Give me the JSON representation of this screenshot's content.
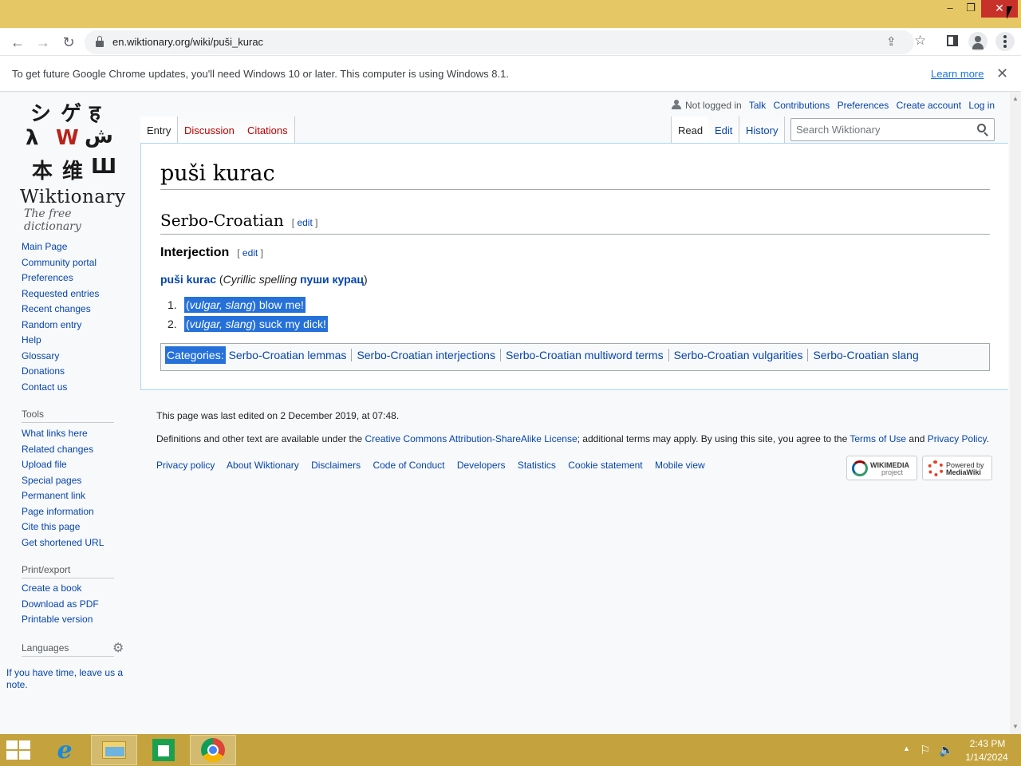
{
  "window": {
    "minimize_label": "‒",
    "restore_label": "❐",
    "close_label": "✕"
  },
  "toolbar": {
    "url": "en.wiktionary.org/wiki/puši_kurac",
    "back_icon": "arrow-left",
    "forward_icon": "arrow-right",
    "reload_icon": "reload"
  },
  "infobar": {
    "message": "To get future Google Chrome updates, you'll need Windows 10 or later. This computer is using Windows 8.1.",
    "learn_more": "Learn more",
    "close_label": "✕"
  },
  "logo": {
    "glyphs": [
      "シ",
      "ゲ",
      "ह",
      "λ",
      "W",
      "ش",
      "本",
      "维",
      "Ш"
    ],
    "wordmark": "Wiktionary",
    "tagline": "The free dictionary"
  },
  "sidebar": {
    "navigation": [
      "Main Page",
      "Community portal",
      "Preferences",
      "Requested entries",
      "Recent changes",
      "Random entry",
      "Help",
      "Glossary",
      "Donations",
      "Contact us"
    ],
    "tools_heading": "Tools",
    "tools": [
      "What links here",
      "Related changes",
      "Upload file",
      "Special pages",
      "Permanent link",
      "Page information",
      "Cite this page",
      "Get shortened URL"
    ],
    "print_heading": "Print/export",
    "print": [
      "Create a book",
      "Download as PDF",
      "Printable version"
    ],
    "languages_heading": "Languages",
    "note": "If you have time, leave us a note."
  },
  "personal": {
    "not_logged_in": "Not logged in",
    "links": [
      "Talk",
      "Contributions",
      "Preferences",
      "Create account",
      "Log in"
    ]
  },
  "tabs": {
    "entry": "Entry",
    "discussion": "Discussion",
    "citations": "Citations",
    "read": "Read",
    "edit": "Edit",
    "history": "History"
  },
  "search": {
    "placeholder": "Search Wiktionary"
  },
  "article": {
    "title": "puši kurac",
    "language": "Serbo-Croatian",
    "pos": "Interjection",
    "edit_open": "[ ",
    "edit_label": "edit",
    "edit_close": " ]",
    "headword": "puši kurac",
    "cyrillic_open": " (",
    "cyrillic_label": "Cyrillic spelling",
    "cyrillic_word": "пуши курац",
    "cyrillic_close": ")",
    "definitions": [
      {
        "num": "1.",
        "paren_open": "(",
        "tags": "vulgar, slang",
        "paren_close": ")",
        "text": " blow me!"
      },
      {
        "num": "2.",
        "paren_open": "(",
        "tags": "vulgar, slang",
        "paren_close": ")",
        "text": " suck my dick!"
      }
    ],
    "categories_label": "Categories:",
    "categories": [
      "Serbo-Croatian lemmas",
      "Serbo-Croatian interjections",
      "Serbo-Croatian multiword terms",
      "Serbo-Croatian vulgarities",
      "Serbo-Croatian slang"
    ]
  },
  "footer": {
    "last_modified": "This page was last edited on 2 December 2019, at 07:48.",
    "license_pre": "Definitions and other text are available under the ",
    "license_link": "Creative Commons Attribution-ShareAlike License",
    "license_mid": "; additional terms may apply. By using this site, you agree to the ",
    "terms_link": "Terms of Use",
    "license_and": " and ",
    "privacy_link": "Privacy Policy",
    "license_end": ".",
    "links": [
      "Privacy policy",
      "About Wiktionary",
      "Disclaimers",
      "Code of Conduct",
      "Developers",
      "Statistics",
      "Cookie statement",
      "Mobile view"
    ],
    "badge_wikimedia": [
      "WIKIMEDIA",
      "project"
    ],
    "badge_mediawiki": [
      "Powered by",
      "MediaWiki"
    ]
  },
  "taskbar": {
    "time": "2:43 PM",
    "date": "1/14/2024",
    "apps": [
      "internet-explorer-icon",
      "file-explorer-icon",
      "store-icon",
      "chrome-icon"
    ]
  },
  "colors": {
    "title_bar": "#e6c766",
    "taskbar": "#c4a33e",
    "link": "#0645ad",
    "redlink": "#ba0000",
    "selection": "#2571d9"
  }
}
